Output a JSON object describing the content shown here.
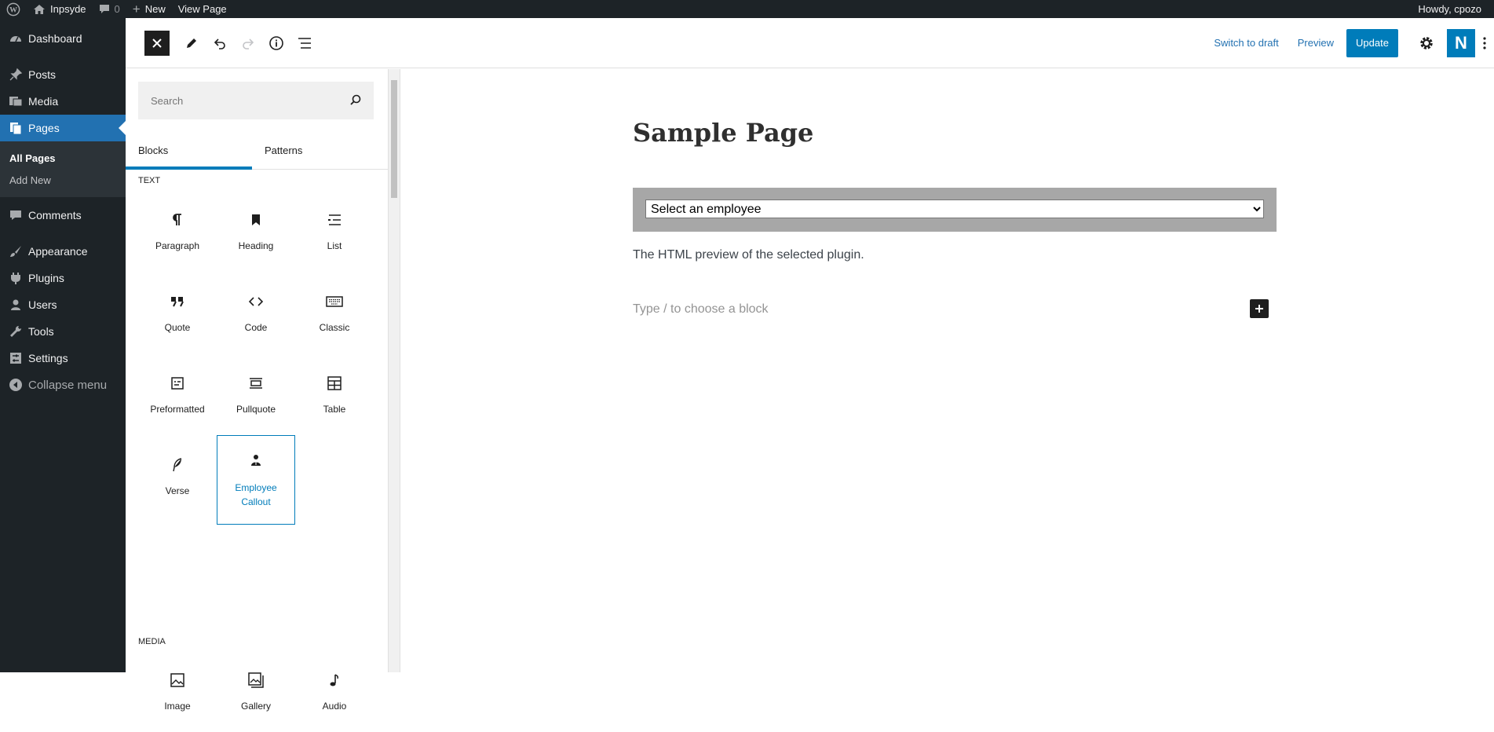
{
  "adminbar": {
    "site_name": "Inpsyde",
    "comments_count": "0",
    "new_label": "New",
    "view_page_label": "View Page",
    "howdy": "Howdy, cpozo"
  },
  "menu": {
    "dashboard": "Dashboard",
    "posts": "Posts",
    "media": "Media",
    "pages": "Pages",
    "all_pages": "All Pages",
    "add_new": "Add New",
    "comments": "Comments",
    "appearance": "Appearance",
    "plugins": "Plugins",
    "users": "Users",
    "tools": "Tools",
    "settings": "Settings",
    "collapse": "Collapse menu"
  },
  "header": {
    "switch_to_draft": "Switch to draft",
    "preview": "Preview",
    "update": "Update",
    "logo_letter": "N"
  },
  "inserter": {
    "search_placeholder": "Search",
    "tabs": [
      "Blocks",
      "Patterns"
    ],
    "text_category": "TEXT",
    "text_blocks": [
      {
        "label": "Paragraph",
        "icon": "paragraph-icon"
      },
      {
        "label": "Heading",
        "icon": "heading-icon"
      },
      {
        "label": "List",
        "icon": "list-icon"
      },
      {
        "label": "Quote",
        "icon": "quote-icon"
      },
      {
        "label": "Code",
        "icon": "code-icon"
      },
      {
        "label": "Classic",
        "icon": "keyboard-icon"
      },
      {
        "label": "Preformatted",
        "icon": "preformatted-icon"
      },
      {
        "label": "Pullquote",
        "icon": "pullquote-icon"
      },
      {
        "label": "Table",
        "icon": "table-icon"
      },
      {
        "label": "Verse",
        "icon": "verse-icon"
      },
      {
        "label": "Employee Callout",
        "icon": "person-icon"
      }
    ],
    "media_category": "MEDIA",
    "media_blocks": [
      {
        "label": "Image",
        "icon": "image-icon"
      },
      {
        "label": "Gallery",
        "icon": "gallery-icon"
      },
      {
        "label": "Audio",
        "icon": "audio-icon"
      }
    ]
  },
  "canvas": {
    "title": "Sample Page",
    "select_value": "Select an employee",
    "preview_text": "The HTML preview of the selected plugin.",
    "block_placeholder": "Type / to choose a block"
  },
  "colors": {
    "admin_dark": "#1d2327",
    "accent": "#2271b1",
    "button_blue": "#007cba"
  }
}
